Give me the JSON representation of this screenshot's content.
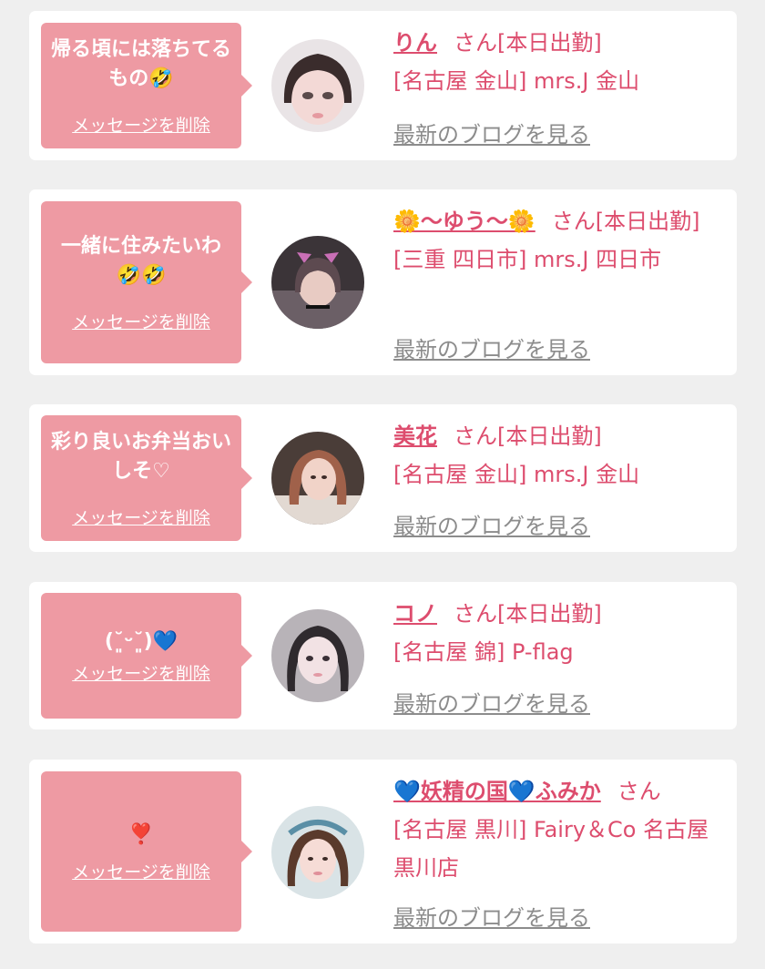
{
  "delete_label": "メッセージを削除",
  "blog_label": "最新のブログを見る",
  "colors": {
    "background": "#efefef",
    "card": "#ffffff",
    "bubble": "#ee9aa3",
    "name": "#dd4d6e",
    "blog_link": "#8c8c8c"
  },
  "cards": [
    {
      "message": "帰る頃には落ちてるもの🤣",
      "name": "りん",
      "status": "さん[本日出勤]",
      "shop": "[名古屋 金山] mrs.J 金山"
    },
    {
      "message": "一緒に住みたいわ🤣🤣",
      "name": "🌼〜ゆう〜🌼",
      "status": "さん[本日出勤]",
      "shop": "[三重 四日市] mrs.J 四日市"
    },
    {
      "message": "彩り良いお弁当おいしそ♡",
      "name": "美花",
      "status": "さん[本日出勤]",
      "shop": "[名古屋 金山] mrs.J 金山"
    },
    {
      "message": "(˘͈ᵕ˘͈)💙",
      "name": "コノ",
      "status": "さん[本日出勤]",
      "shop": "[名古屋 錦] P-flag"
    },
    {
      "message": "❣️",
      "name": "💙妖精の国💙ふみか",
      "status": "さん",
      "shop": "[名古屋 黒川] Fairy＆Co 名古屋黒川店"
    }
  ]
}
